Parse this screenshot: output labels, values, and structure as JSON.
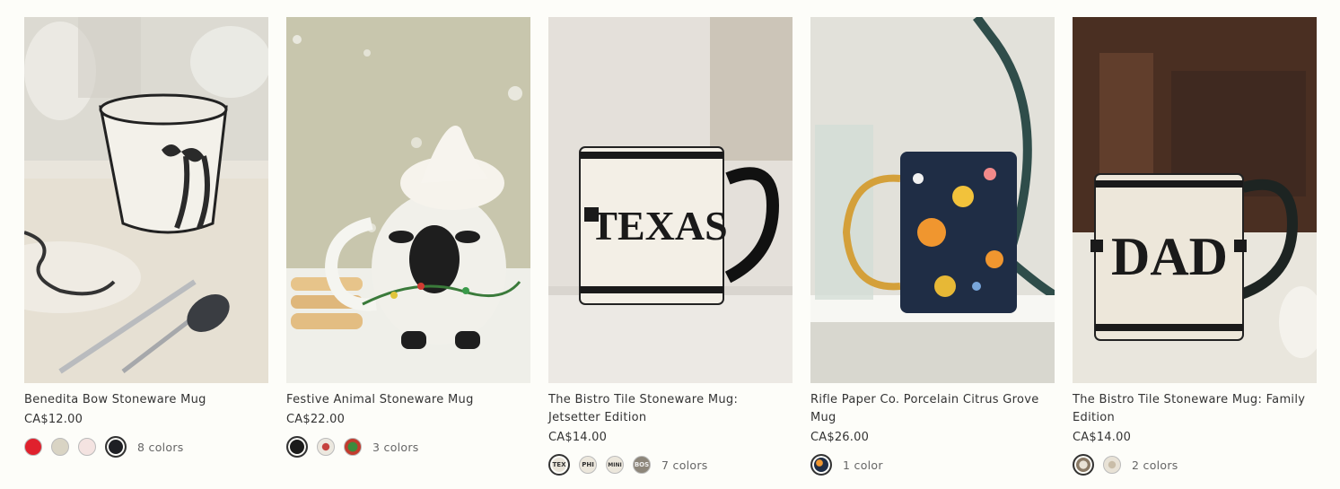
{
  "products": [
    {
      "title": "Benedita Bow Stoneware Mug",
      "price": "CA$12.00",
      "colors_label": "8 colors",
      "swatches": [
        "#e0212d",
        "#d9d4c4",
        "#f4e3e1",
        "#1e1f24"
      ],
      "image": "benedita-bow-mug-photo"
    },
    {
      "title": "Festive Animal Stoneware Mug",
      "price": "CA$22.00",
      "colors_label": "3 colors",
      "swatches": [
        "#1b1b1b",
        "#c5413d",
        "#3d8b3d"
      ],
      "image": "festive-sheep-mug-photo"
    },
    {
      "title": "The Bistro Tile Stoneware Mug: Jetsetter Edition",
      "price": "CA$14.00",
      "colors_label": "7 colors",
      "swatches": [
        "TEX",
        "PHI",
        "MINI",
        "BOS"
      ],
      "image": "bistro-tile-texas-mug-photo"
    },
    {
      "title": "Rifle Paper Co. Porcelain Citrus Grove Mug",
      "price": "CA$26.00",
      "colors_label": "1 color",
      "swatches": [
        "#1f2d45"
      ],
      "image": "citrus-grove-mug-photo"
    },
    {
      "title": "The Bistro Tile Stoneware Mug: Family Edition",
      "price": "CA$14.00",
      "colors_label": "2 colors",
      "swatches": [
        "#8a7a66",
        "#e8e2d6"
      ],
      "image": "bistro-tile-dad-mug-photo"
    }
  ],
  "mug_labels": {
    "texas": "TEXAS",
    "dad": "DAD"
  }
}
